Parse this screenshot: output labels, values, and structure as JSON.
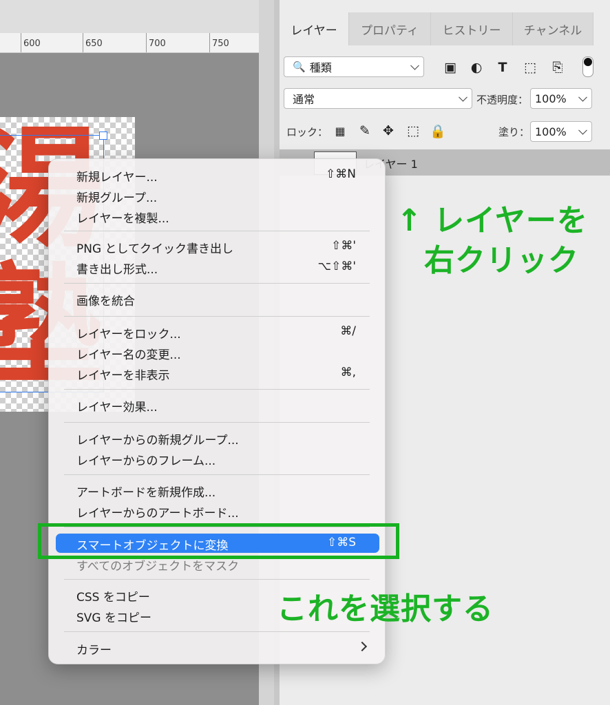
{
  "ruler": {
    "ticks": [
      "600",
      "650",
      "700",
      "750"
    ]
  },
  "canvas": {
    "kanji_top": "湯",
    "kanji_bottom": "塾"
  },
  "panel": {
    "tabs": [
      {
        "label": "レイヤー",
        "active": true
      },
      {
        "label": "プロパティ",
        "active": false
      },
      {
        "label": "ヒストリー",
        "active": false
      },
      {
        "label": "チャンネル",
        "active": false
      }
    ],
    "filter": {
      "value": "種類"
    },
    "blend": {
      "value": "通常"
    },
    "opacity": {
      "label": "不透明度：",
      "value": "100%"
    },
    "lock": {
      "label": "ロック："
    },
    "fill": {
      "label": "塗り：",
      "value": "100%"
    },
    "layer": {
      "name": "レイヤー 1"
    }
  },
  "menu": {
    "items": [
      {
        "label": "新規レイヤー...",
        "shortcut": "⇧⌘N"
      },
      {
        "label": "新規グループ...",
        "shortcut": ""
      },
      {
        "label": "レイヤーを複製...",
        "shortcut": ""
      },
      {
        "label": "PNG としてクイック書き出し",
        "shortcut": "⇧⌘'"
      },
      {
        "label": "書き出し形式...",
        "shortcut": "⌥⇧⌘'"
      },
      {
        "label": "画像を統合",
        "shortcut": ""
      },
      {
        "label": "レイヤーをロック...",
        "shortcut": "⌘/"
      },
      {
        "label": "レイヤー名の変更...",
        "shortcut": ""
      },
      {
        "label": "レイヤーを非表示",
        "shortcut": "⌘,"
      },
      {
        "label": "レイヤー効果...",
        "shortcut": ""
      },
      {
        "label": "レイヤーからの新規グループ...",
        "shortcut": ""
      },
      {
        "label": "レイヤーからのフレーム...",
        "shortcut": ""
      },
      {
        "label": "アートボードを新規作成...",
        "shortcut": ""
      },
      {
        "label": "レイヤーからのアートボード...",
        "shortcut": ""
      },
      {
        "label": "スマートオブジェクトに変換",
        "shortcut": "⇧⌘S",
        "selected": true
      },
      {
        "label": "すべてのオブジェクトをマスク",
        "shortcut": ""
      },
      {
        "label": "CSS をコピー",
        "shortcut": ""
      },
      {
        "label": "SVG をコピー",
        "shortcut": ""
      },
      {
        "label": "カラー",
        "shortcut": ""
      }
    ]
  },
  "annotations": {
    "right_click_line1": "↑ レイヤーを",
    "right_click_line2": "右クリック",
    "select_this": "これを選択する"
  },
  "colors": {
    "highlight": "#2f82f5",
    "annotation_green": "#1cb326",
    "kanji_red": "#d9442c"
  }
}
